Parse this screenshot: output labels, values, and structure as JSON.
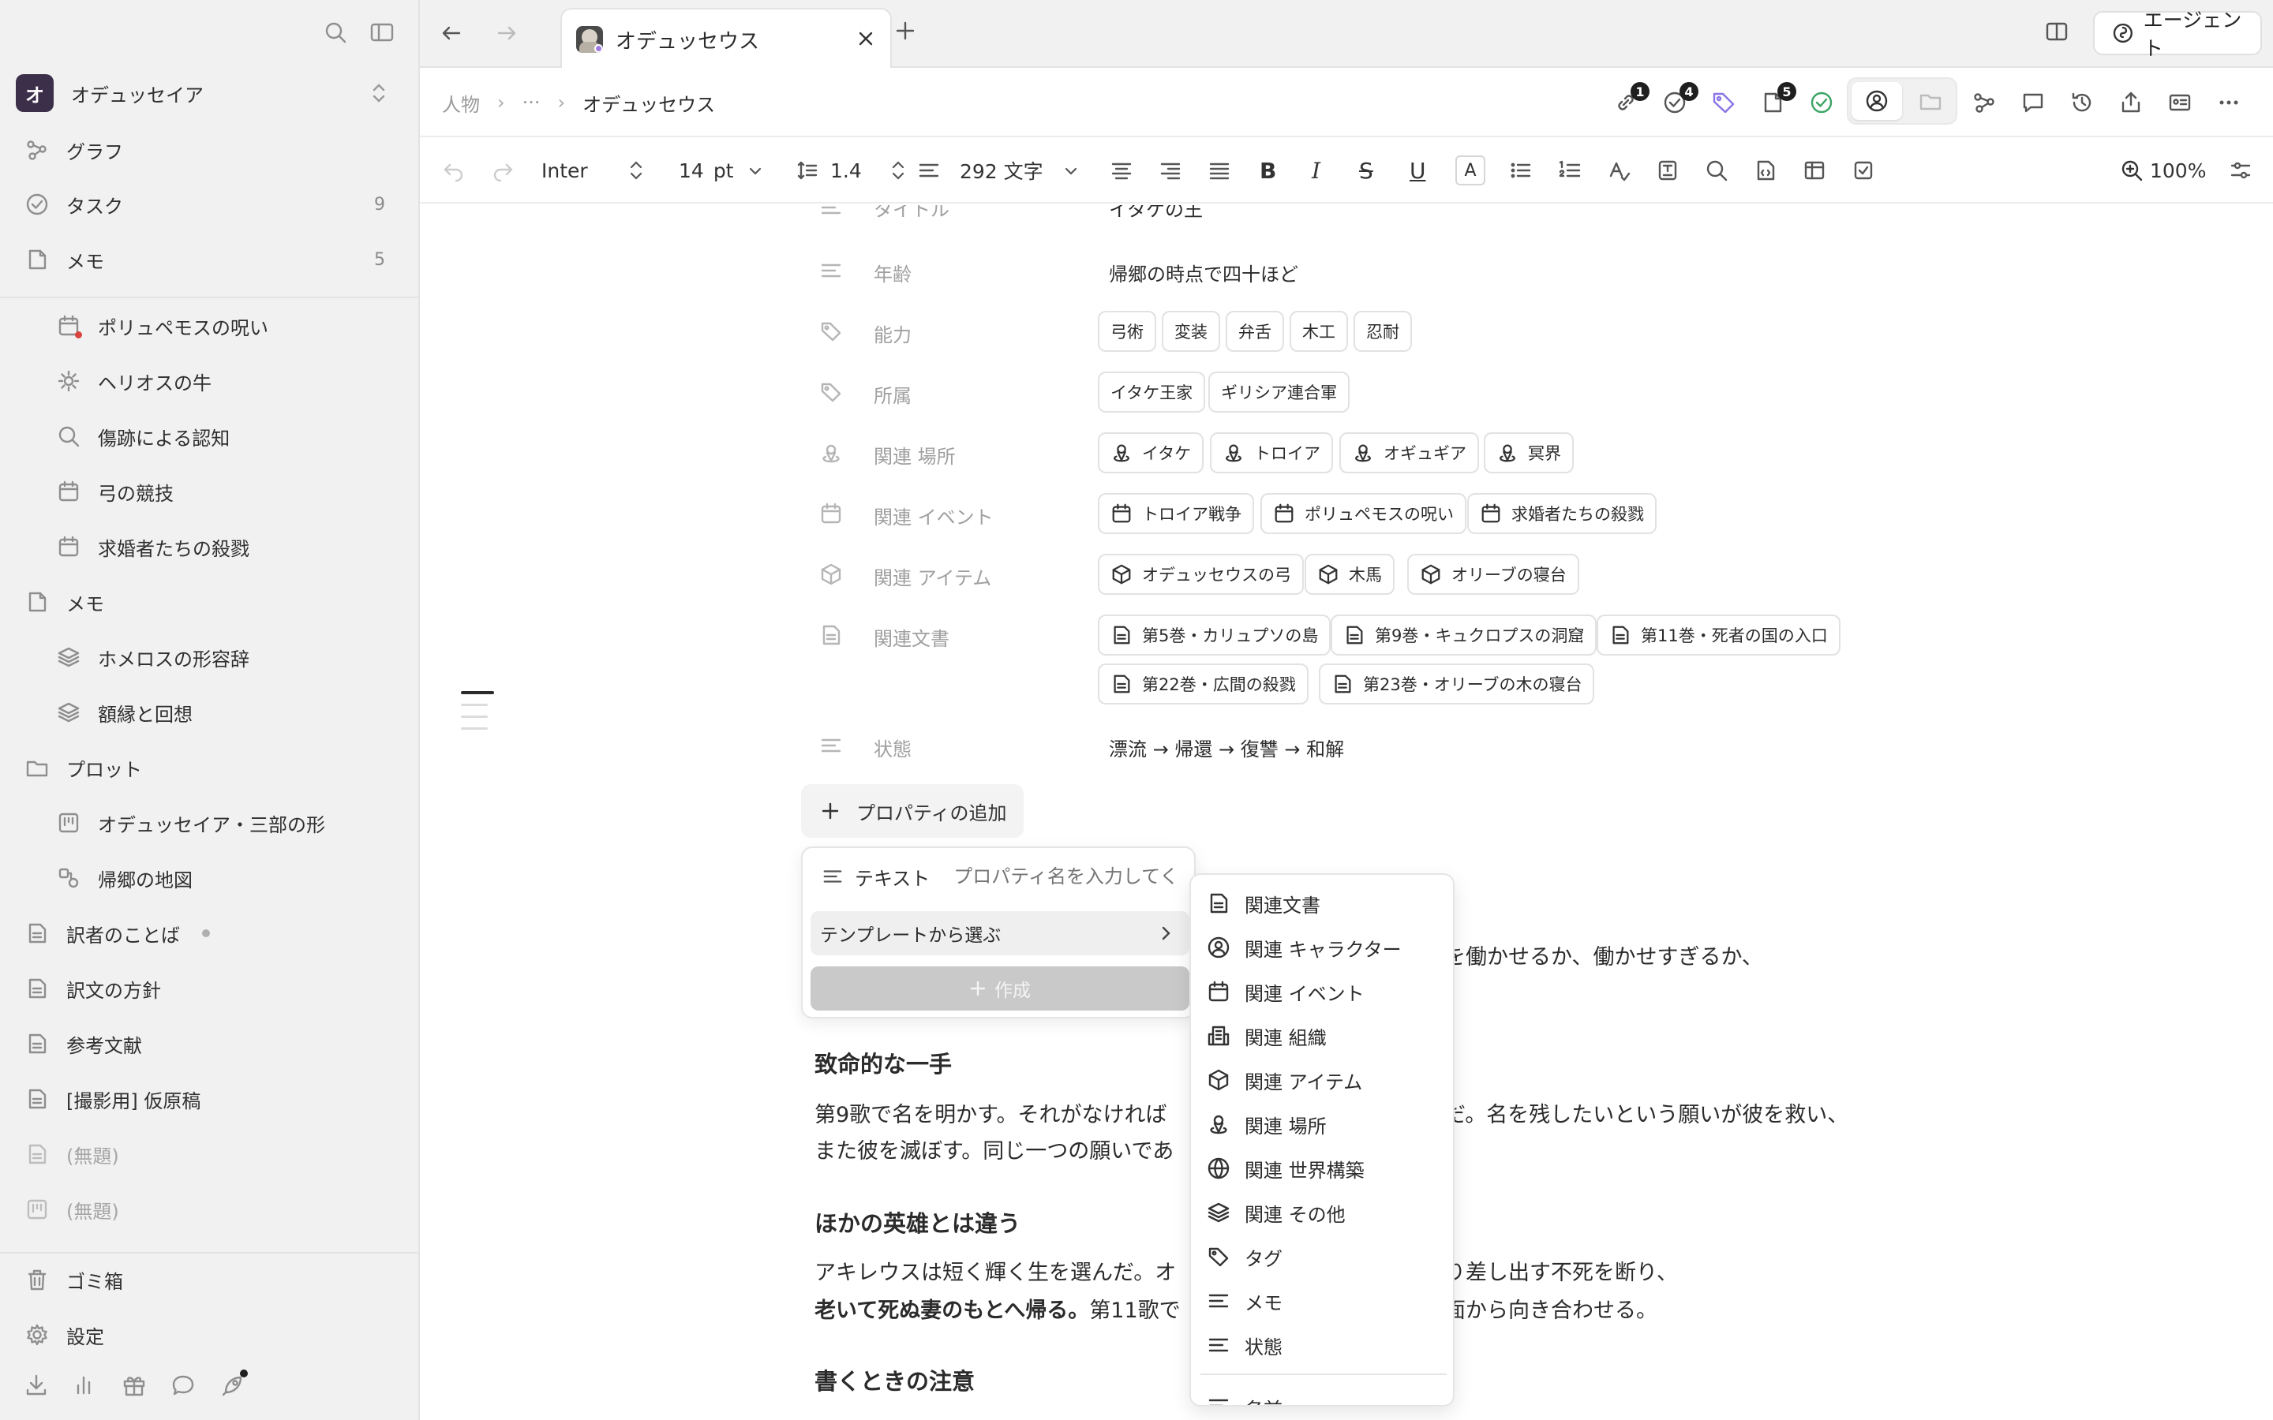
{
  "workspace": {
    "initial": "オ",
    "name": "オデュッセイア"
  },
  "sidebar": {
    "top": [
      {
        "label": "グラフ",
        "icon": "graph-icon",
        "count": ""
      },
      {
        "label": "タスク",
        "icon": "check-circle-icon",
        "count": "9"
      },
      {
        "label": "メモ",
        "icon": "memo-icon",
        "count": "5"
      }
    ],
    "memos": [
      {
        "label": "ポリュペモスの呪い",
        "icon": "calendar-icon"
      },
      {
        "label": "ヘリオスの牛",
        "icon": "sun-icon"
      },
      {
        "label": "傷跡による認知",
        "icon": "search-icon"
      },
      {
        "label": "弓の競技",
        "icon": "calendar-icon"
      },
      {
        "label": "求婚者たちの殺戮",
        "icon": "calendar-icon"
      }
    ],
    "memo_folder": {
      "label": "メモ"
    },
    "memo_children": [
      {
        "label": "ホメロスの形容辞",
        "icon": "stack-icon"
      },
      {
        "label": "額縁と回想",
        "icon": "stack-icon"
      }
    ],
    "plot_folder": {
      "label": "プロット"
    },
    "plot_children": [
      {
        "label": "オデュッセイア・三部の形",
        "icon": "board-icon"
      },
      {
        "label": "帰郷の地図",
        "icon": "map-icon"
      }
    ],
    "docs": [
      {
        "label": "訳者のことば",
        "icon": "doc-icon"
      },
      {
        "label": "訳文の方針",
        "icon": "doc-icon"
      },
      {
        "label": "参考文献",
        "icon": "doc-icon"
      },
      {
        "label": "[撮影用] 仮原稿",
        "icon": "doc-icon"
      },
      {
        "label": "(無題)",
        "icon": "doc-icon"
      },
      {
        "label": "(無題)",
        "icon": "board-icon"
      }
    ],
    "trash": "ゴミ箱",
    "settings": "設定"
  },
  "tab": {
    "title": "オデュッセウス"
  },
  "header": {
    "agent_label": "エージェント"
  },
  "breadcrumb": {
    "root": "人物",
    "ellipsis": "···",
    "current": "オデュッセウス"
  },
  "badges": {
    "links": "1",
    "tasks": "4",
    "docs": "5"
  },
  "toolbar": {
    "font": "Inter",
    "size": "14",
    "unit": "pt",
    "line_height": "1.4",
    "word_count": "292 文字",
    "zoom": "100%"
  },
  "properties": {
    "title_label": "タイトル",
    "title_value": "イタケの王",
    "age_label": "年齢",
    "age_value": "帰郷の時点で四十ほど",
    "abilities_label": "能力",
    "abilities": [
      "弓術",
      "変装",
      "弁舌",
      "木工",
      "忍耐"
    ],
    "affiliation_label": "所属",
    "affiliation": [
      "イタケ王家",
      "ギリシア連合軍"
    ],
    "places_label": "関連 場所",
    "places": [
      "イタケ",
      "トロイア",
      "オギュギア",
      "冥界"
    ],
    "events_label": "関連 イベント",
    "events": [
      "トロイア戦争",
      "ポリュペモスの呪い",
      "求婚者たちの殺戮"
    ],
    "items_label": "関連 アイテム",
    "items": [
      "オデュッセウスの弓",
      "木馬",
      "オリーブの寝台"
    ],
    "docs_label": "関連文書",
    "docs": [
      "第5巻・カリュプソの島",
      "第9巻・キュクロプスの洞窟",
      "第11巻・死者の国の入口",
      "第22巻・広間の殺戮",
      "第23巻・オリーブの木の寝台"
    ],
    "state_label": "状態",
    "state_value": "漂流 → 帰還 → 復讐 → 和解",
    "add_label": "プロパティの追加"
  },
  "add_panel": {
    "type_label": "テキスト",
    "name_placeholder": "プロパティ名を入力してく",
    "template_label": "テンプレートから選ぶ",
    "create_label": "作成"
  },
  "template_menu": [
    {
      "label": "関連文書",
      "icon": "doc-icon"
    },
    {
      "label": "関連 キャラクター",
      "icon": "person-circle-icon"
    },
    {
      "label": "関連 イベント",
      "icon": "calendar-icon"
    },
    {
      "label": "関連 組織",
      "icon": "building-icon"
    },
    {
      "label": "関連 アイテム",
      "icon": "cube-icon"
    },
    {
      "label": "関連 場所",
      "icon": "location-person-icon"
    },
    {
      "label": "関連 世界構築",
      "icon": "globe-icon"
    },
    {
      "label": "関連 その他",
      "icon": "stack-icon"
    },
    {
      "label": "タグ",
      "icon": "tag-icon"
    },
    {
      "label": "メモ",
      "icon": "lines-icon"
    },
    {
      "label": "状態",
      "icon": "lines-icon"
    },
    {
      "label": "名前",
      "icon": "lines-icon"
    }
  ],
  "content": {
    "p1_tail": "を働かせるか、働かせすぎるか、",
    "h_fatal": "致命的な一手",
    "p2_line1a": "第9歌で名を明かす。それがなければ",
    "p2_line1b": "だ。名を残したいという願いが彼を救い、",
    "p2_line2": "また彼を滅ぼす。同じ一つの願いであ",
    "h_other": "ほかの英雄とは違う",
    "p3_line1a": "アキレウスは短く輝く生を選んだ。オ",
    "p3_line1b": "り差し出す不死を断り、",
    "p3_line2a": "老いて死ぬ妻のもとへ帰る。",
    "p3_line2b": "第11歌で",
    "p3_line2c": "面から向き合わせる。",
    "h_notes": "書くときの注意"
  }
}
